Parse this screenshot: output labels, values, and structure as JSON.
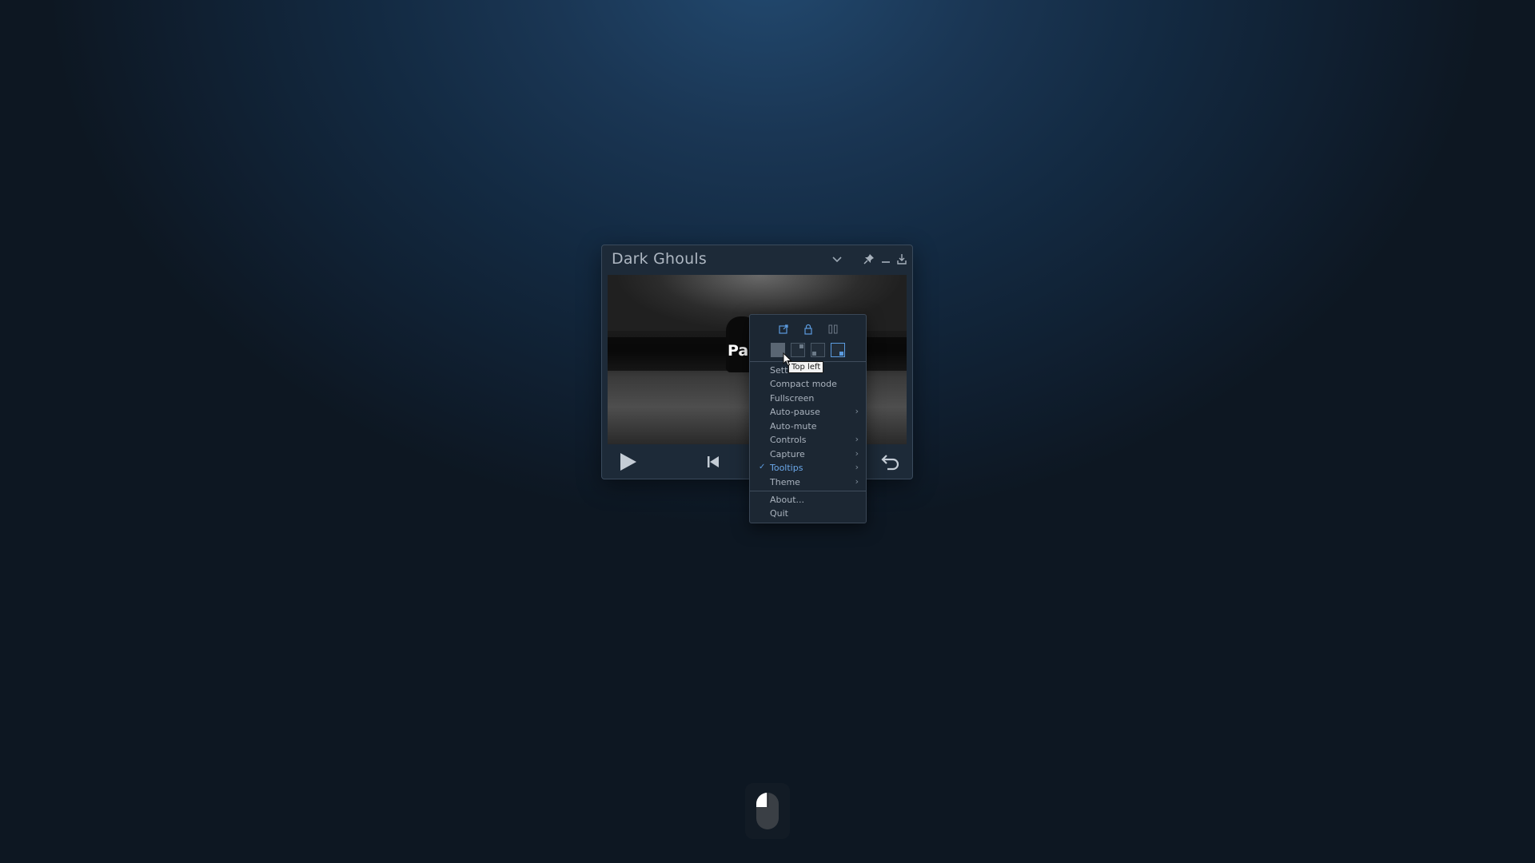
{
  "window": {
    "title": "Dark Ghouls"
  },
  "video": {
    "overlay_text": "Pa"
  },
  "menu": {
    "top_icons": [
      "external-link-icon",
      "lock-icon",
      "pause-bars-icon"
    ],
    "corner_positions": [
      "top-left",
      "top-right",
      "bottom-left",
      "bottom-right"
    ],
    "selected_corner": "bottom-right",
    "items": [
      {
        "label": "Sett",
        "submenu": false
      },
      {
        "label": "Compact mode",
        "submenu": false
      },
      {
        "label": "Fullscreen",
        "submenu": false
      },
      {
        "label": "Auto-pause",
        "submenu": true
      },
      {
        "label": "Auto-mute",
        "submenu": false
      },
      {
        "label": "Controls",
        "submenu": true
      },
      {
        "label": "Capture",
        "submenu": true
      },
      {
        "label": "Tooltips",
        "submenu": true,
        "checked": true
      },
      {
        "label": "Theme",
        "submenu": true
      }
    ],
    "footer_items": [
      {
        "label": "About..."
      },
      {
        "label": "Quit"
      }
    ],
    "check_glyph": "✓",
    "arrow_glyph": "›"
  },
  "tooltip": {
    "text": "Top left"
  },
  "colors": {
    "accent": "#5b9bdf",
    "menu_bg": "#1c2733",
    "window_bg": "#1d2a38"
  }
}
